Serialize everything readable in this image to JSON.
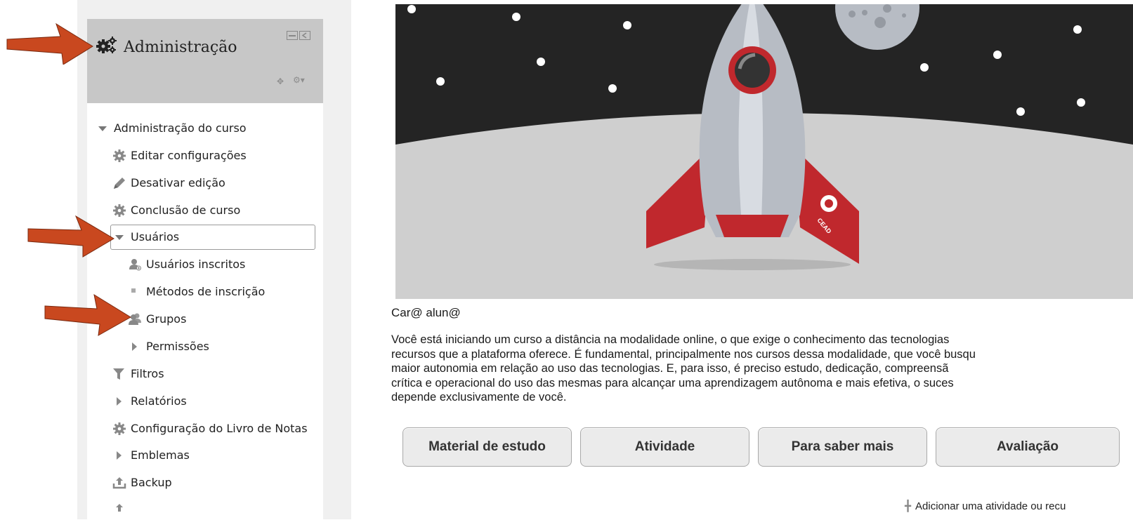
{
  "admin_block": {
    "title": "Administração",
    "items": [
      {
        "label": "Administração do curso",
        "icon": "triangle-down-icon"
      },
      {
        "label": "Editar configurações",
        "icon": "gear-icon"
      },
      {
        "label": "Desativar edição",
        "icon": "pencil-icon"
      },
      {
        "label": "Conclusão de curso",
        "icon": "gear-icon"
      },
      {
        "label": "Usuários",
        "icon": "triangle-down-icon"
      },
      {
        "label": "Usuários inscritos",
        "icon": "user-enrol-icon"
      },
      {
        "label": "Métodos de inscrição",
        "icon": "bullet-icon"
      },
      {
        "label": "Grupos",
        "icon": "group-icon"
      },
      {
        "label": "Permissões",
        "icon": "triangle-right-icon"
      },
      {
        "label": "Filtros",
        "icon": "filter-icon"
      },
      {
        "label": "Relatórios",
        "icon": "triangle-right-icon"
      },
      {
        "label": "Configuração do Livro de Notas",
        "icon": "gear-icon"
      },
      {
        "label": "Emblemas",
        "icon": "triangle-right-icon"
      },
      {
        "label": "Backup",
        "icon": "upload-icon"
      }
    ]
  },
  "content": {
    "greeting": "Car@ alun@",
    "intro_lines": [
      "Você está iniciando um curso a distância na modalidade online, o que exige o conhecimento das tecnologias",
      "recursos que a plataforma oferece. É fundamental, principalmente nos cursos dessa modalidade, que você busqu",
      "maior autonomia em relação ao uso das tecnologias. E, para isso, é preciso estudo, dedicação, compreensã",
      "crítica e operacional do uso das mesmas para alcançar uma aprendizagem autônoma e mais efetiva, o suces",
      "depende exclusivamente de você."
    ],
    "buttons": [
      "Material de estudo",
      "Atividade",
      "Para saber mais",
      "Avaliação"
    ],
    "add_activity": "Adicionar uma atividade ou recu"
  },
  "banner": {
    "logo_text": "CEAD",
    "colors": {
      "sky": "#242424",
      "ground": "#cfcfcf",
      "rocket_red": "#c0282d",
      "rocket_body": "#b7bcc4"
    }
  },
  "colors": {
    "arrow": "#c9481f",
    "block_header": "#c7c7c7",
    "button_bg": "#ebebeb"
  }
}
